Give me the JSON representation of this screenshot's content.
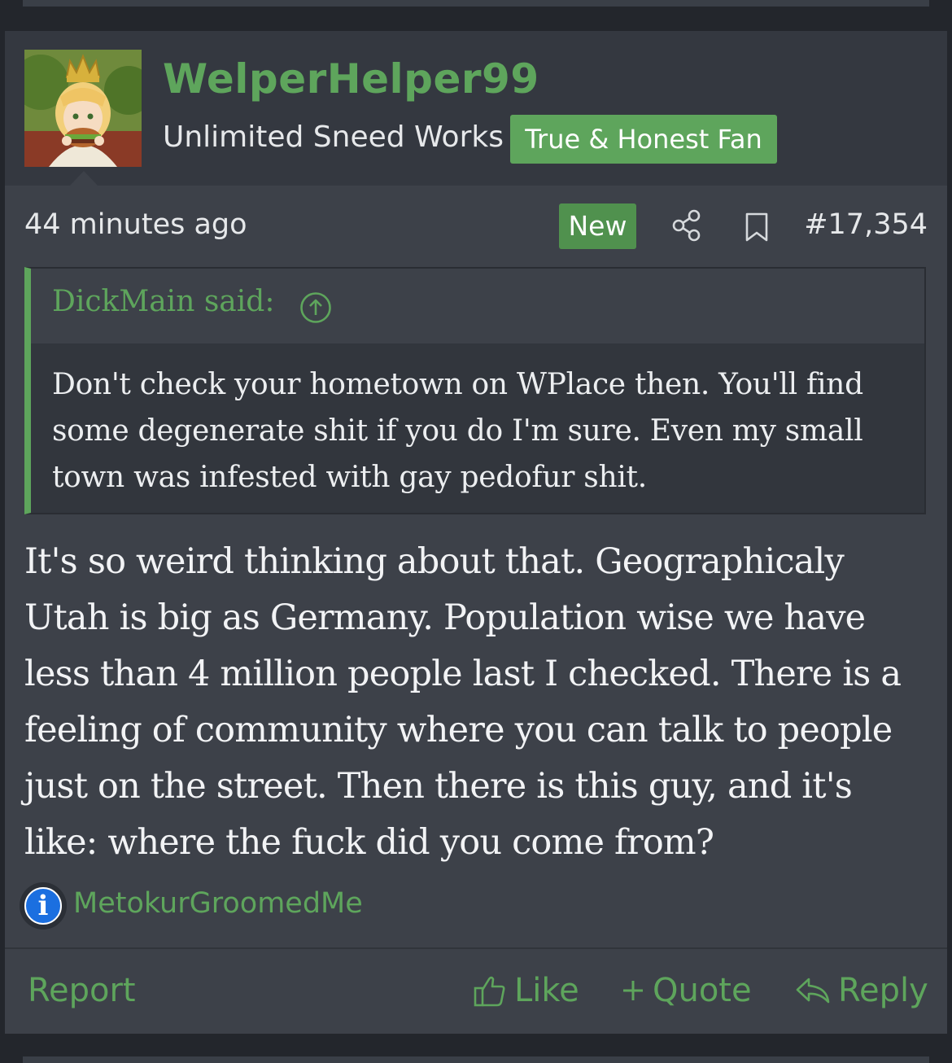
{
  "author": {
    "username": "WelperHelper99",
    "title": "Unlimited Sneed Works",
    "badge": "True & Honest Fan"
  },
  "post": {
    "time": "44 minutes ago",
    "new_badge": "New",
    "number": "#17,354",
    "message": "It's so weird thinking about that. Geographicaly Utah is big as Germany. Population wise we have less than 4 million people last I checked. There is a feeling of community where you can talk to people just on the street. Then there is this guy, and it's like: where the fuck did you come from?"
  },
  "quote": {
    "author": "DickMain said:",
    "body": "Don't check your hometown on WPlace then. You'll find some degenerate shit if you do I'm sure. Even my small town was infested with gay pedofur shit."
  },
  "reactions": {
    "icon_glyph": "i",
    "user": "MetokurGroomedMe"
  },
  "footer": {
    "report": "Report",
    "like": "Like",
    "quote": "Quote",
    "reply": "Reply"
  },
  "colors": {
    "accent": "#5ea55c",
    "post_bg": "#3d4149",
    "header_bg": "#343840",
    "page_bg": "#23262c"
  }
}
